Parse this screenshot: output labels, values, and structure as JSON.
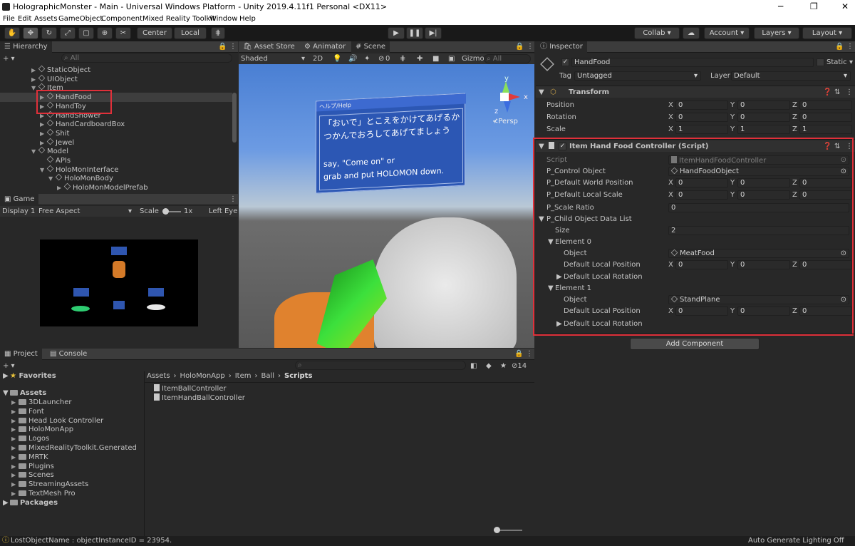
{
  "titlebar": {
    "title": "HolographicMonster - Main - Universal Windows Platform - Unity 2019.4.11f1 Personal <DX11>",
    "min": "─",
    "max": "❐",
    "close": "✕"
  },
  "menu": [
    "File",
    "Edit",
    "Assets",
    "GameObject",
    "Component",
    "Mixed Reality Toolkit",
    "Window",
    "Help"
  ],
  "toolbar": {
    "center": "Center",
    "local": "Local",
    "collab": "Collab ▾",
    "account": "Account",
    "layers": "Layers",
    "layout": "Layout"
  },
  "hierarchy": {
    "tab": "Hierarchy",
    "search": "All",
    "add": "+ ▾",
    "items": [
      {
        "label": "StaticObject",
        "indent": 4
      },
      {
        "label": "UIObject",
        "indent": 4
      },
      {
        "label": "Item",
        "indent": 4
      },
      {
        "label": "HandFood",
        "indent": 5
      },
      {
        "label": "HandToy",
        "indent": 5
      },
      {
        "label": "HandShower",
        "indent": 5
      },
      {
        "label": "HandCardboardBox",
        "indent": 5
      },
      {
        "label": "Shit",
        "indent": 5
      },
      {
        "label": "Jewel",
        "indent": 5
      },
      {
        "label": "Model",
        "indent": 4
      },
      {
        "label": "APIs",
        "indent": 5
      },
      {
        "label": "HoloMonInterface",
        "indent": 5
      },
      {
        "label": "HoloMonBody",
        "indent": 6
      },
      {
        "label": "HoloMonModelPrefab",
        "indent": 7
      }
    ]
  },
  "game": {
    "tab": "Game",
    "display": "Display 1",
    "aspect": "Free Aspect",
    "scale": "Scale",
    "scale_val": "1x",
    "eye": "Left Eye"
  },
  "scene": {
    "tabs": [
      "Asset Store",
      "Animator",
      "Scene"
    ],
    "shaded": "Shaded",
    "mode2d": "2D",
    "gizmos": "Gizmos",
    "search": "All",
    "layers_count": "0",
    "persp": "≮Persp",
    "help_title": "ヘルプ/Help",
    "help_jp1": "「おいで」とこえをかけてあげるか",
    "help_jp2": "つかんでおろしてあげてましょう",
    "help_en1": "say, \"Come on\" or",
    "help_en2": "grab and put HOLOMON down.",
    "axis_y": "y",
    "axis_x": "x",
    "axis_z": "z"
  },
  "inspector": {
    "tab": "Inspector",
    "name": "HandFood",
    "static": "Static",
    "tag_label": "Tag",
    "tag": "Untagged",
    "layer_label": "Layer",
    "layer": "Default",
    "transform": {
      "title": "Transform",
      "rows": [
        {
          "label": "Position",
          "x": "0",
          "y": "0",
          "z": "0"
        },
        {
          "label": "Rotation",
          "x": "0",
          "y": "0",
          "z": "0"
        },
        {
          "label": "Scale",
          "x": "1",
          "y": "1",
          "z": "1"
        }
      ]
    },
    "script": {
      "title": "Item Hand Food Controller (Script)",
      "script_label": "Script",
      "script_val": "ItemHandFoodController",
      "control_label": "P_Control Object",
      "control_val": "HandFoodObject",
      "dwp_label": "P_Default World Position",
      "dwp": [
        "0",
        "0",
        "0"
      ],
      "dls_label": "P_Default Local Scale",
      "dls": [
        "0",
        "0",
        "0"
      ],
      "ratio_label": "P_Scale Ratio",
      "ratio": "0",
      "list_label": "P_Child Object Data List",
      "size_label": "Size",
      "size": "2",
      "el0": "Element 0",
      "el1": "Element 1",
      "obj_label": "Object",
      "obj0": "MeatFood",
      "obj1": "StandPlane",
      "dlp_label": "Default Local Position",
      "dlp0": [
        "0",
        "0",
        "0"
      ],
      "dlp1": [
        "0",
        "0",
        "0"
      ],
      "dlr_label": "Default Local Rotation"
    },
    "add_component": "Add Component",
    "xl": "X",
    "yl": "Y",
    "zl": "Z"
  },
  "project": {
    "tabs": [
      "Project",
      "Console"
    ],
    "favorites": "Favorites",
    "assets": "Assets",
    "packages": "Packages",
    "folders": [
      "3DLauncher",
      "Font",
      "Head Look Controller",
      "HoloMonApp",
      "Logos",
      "MixedRealityToolkit.Generated",
      "MRTK",
      "Plugins",
      "Scenes",
      "StreamingAssets",
      "TextMesh Pro"
    ],
    "breadcrumb": [
      "Assets",
      "HoloMonApp",
      "Item",
      "Ball",
      "Scripts"
    ],
    "files": [
      "ItemBallController",
      "ItemHandBallController"
    ],
    "count": "14"
  },
  "status": {
    "left": "LostObjectName : objectInstanceID = 23954.",
    "right": "Auto Generate Lighting Off"
  }
}
